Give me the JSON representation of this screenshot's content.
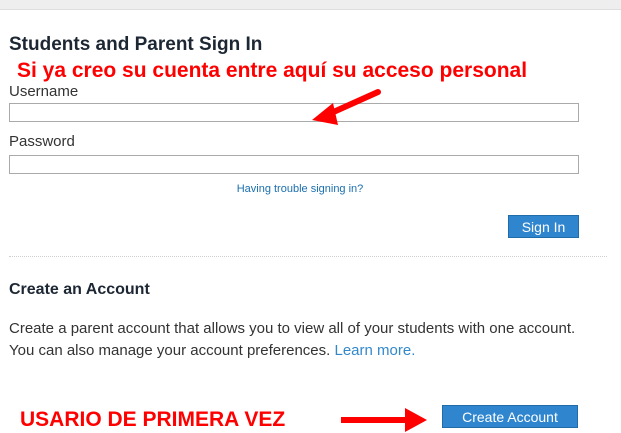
{
  "signin": {
    "title": "Students and Parent Sign In",
    "username_label": "Username",
    "username_value": "",
    "password_label": "Password",
    "password_value": "",
    "trouble_link": "Having trouble signing in?",
    "signin_button": "Sign In"
  },
  "create": {
    "title": "Create an Account",
    "description": "Create a parent account that allows you to view all of your students with one account. You can also manage your account preferences.",
    "learn_more": "Learn more.",
    "button": "Create Account"
  },
  "annotations": {
    "top_note": "Si ya creo su cuenta entre aquí su acceso personal",
    "bottom_note": "USARIO DE PRIMERA VEZ",
    "color": "#ff0000"
  },
  "colors": {
    "accent": "#2f86cf",
    "link": "#1a6fb0"
  }
}
